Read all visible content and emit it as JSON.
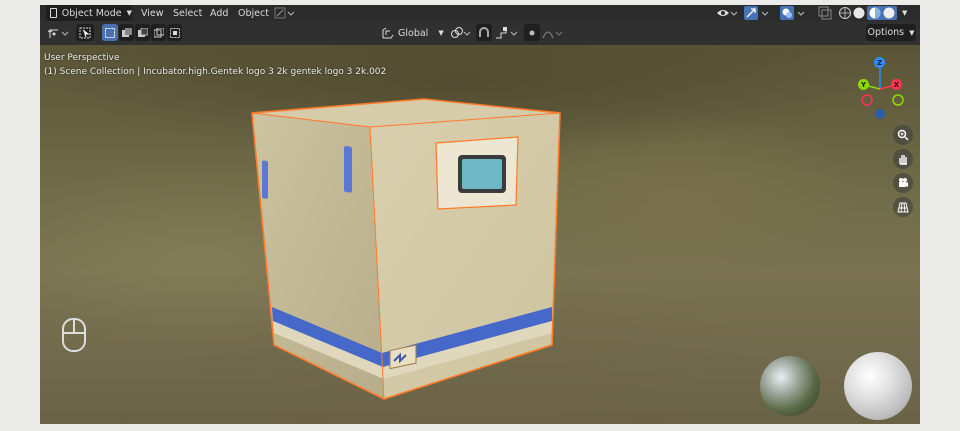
{
  "header": {
    "mode_label": "Object Mode",
    "menus": [
      "View",
      "Select",
      "Add",
      "Object"
    ]
  },
  "toolbar": {
    "orientation_label": "Global",
    "options_label": "Options"
  },
  "viewport": {
    "perspective_label": "User Perspective",
    "collection_label": "(1) Scene Collection | Incubator.high.Gentek   logo 3   2k gentek   logo 3   2k.002",
    "gizmo": {
      "z": "Z",
      "y": "Y",
      "x": "X"
    }
  },
  "icons": [
    "editor-type-icon",
    "chevron-down-icon",
    "select-tool-icon",
    "select-mode-icons",
    "transform-pivot-icon",
    "snap-icon",
    "proportional-edit-icon",
    "visibility-icon",
    "gizmo-icon",
    "overlay-icon",
    "xray-icon",
    "shading-wireframe-icon",
    "shading-solid-icon",
    "shading-material-icon",
    "shading-rendered-icon",
    "zoom-icon",
    "hand-icon",
    "camera-icon",
    "grid-icon",
    "mouse-icon"
  ],
  "colors": {
    "header_bg": "#2b2b2b",
    "accent_blue": "#4772b3",
    "selection_outline": "#ff7a29",
    "axis_x": "#ff3352",
    "axis_y": "#8bdc00",
    "axis_z": "#2890ff"
  }
}
